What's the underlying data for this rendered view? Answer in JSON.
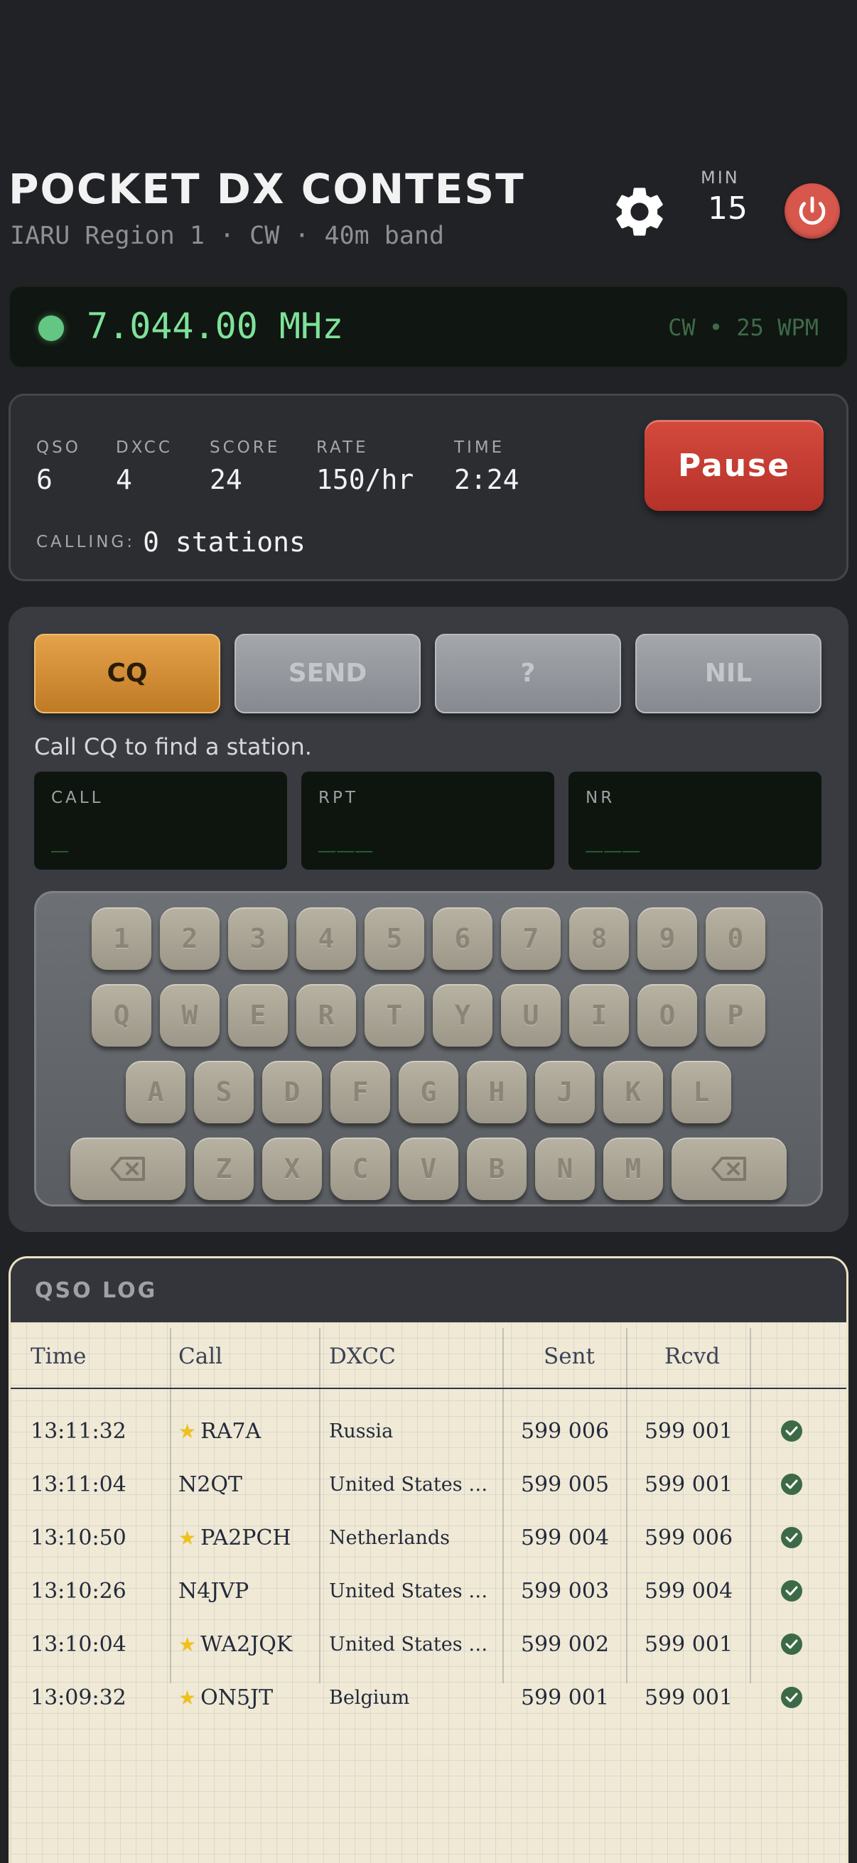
{
  "header": {
    "title": "POCKET DX CONTEST",
    "subtitle": "IARU Region 1 · CW · 40m band",
    "min_label": "MIN",
    "min_value": "15"
  },
  "radio": {
    "frequency": "7.044.00 MHz",
    "mode_info": "CW • 25 WPM",
    "status_color": "#63c783"
  },
  "stats": {
    "qso_label": "QSO",
    "qso_value": "6",
    "dxcc_label": "DXCC",
    "dxcc_value": "4",
    "score_label": "SCORE",
    "score_value": "24",
    "rate_label": "RATE",
    "rate_value": "150/hr",
    "time_label": "TIME",
    "time_value": "2:24",
    "calling_label": "CALLING:",
    "calling_value": "0 stations",
    "pause_label": "Pause"
  },
  "controls": {
    "buttons": [
      "CQ",
      "SEND",
      "?",
      "NIL"
    ],
    "active_button": "CQ",
    "prompt": "Call CQ to find a station.",
    "fields": [
      {
        "label": "CALL",
        "value": "_"
      },
      {
        "label": "RPT",
        "value": "___"
      },
      {
        "label": "NR",
        "value": "___"
      }
    ]
  },
  "keyboard": {
    "row1": [
      "1",
      "2",
      "3",
      "4",
      "5",
      "6",
      "7",
      "8",
      "9",
      "0"
    ],
    "row2": [
      "Q",
      "W",
      "E",
      "R",
      "T",
      "Y",
      "U",
      "I",
      "O",
      "P"
    ],
    "row3": [
      "A",
      "S",
      "D",
      "F",
      "G",
      "H",
      "J",
      "K",
      "L"
    ],
    "row4": [
      "Z",
      "X",
      "C",
      "V",
      "B",
      "N",
      "M"
    ],
    "backspace_icon": "backspace-icon"
  },
  "log": {
    "title": "QSO LOG",
    "columns": [
      "Time",
      "Call",
      "DXCC",
      "Sent",
      "Rcvd"
    ],
    "rows": [
      {
        "time": "13:11:32",
        "call": "RA7A",
        "starred": true,
        "dxcc": "Russia",
        "sent": "599 006",
        "rcvd": "599 001",
        "confirmed": true
      },
      {
        "time": "13:11:04",
        "call": "N2QT",
        "starred": false,
        "dxcc": "United States of America",
        "sent": "599 005",
        "rcvd": "599 001",
        "confirmed": true
      },
      {
        "time": "13:10:50",
        "call": "PA2PCH",
        "starred": true,
        "dxcc": "Netherlands",
        "sent": "599 004",
        "rcvd": "599 006",
        "confirmed": true
      },
      {
        "time": "13:10:26",
        "call": "N4JVP",
        "starred": false,
        "dxcc": "United States of America",
        "sent": "599 003",
        "rcvd": "599 004",
        "confirmed": true
      },
      {
        "time": "13:10:04",
        "call": "WA2JQK",
        "starred": true,
        "dxcc": "United States of America",
        "sent": "599 002",
        "rcvd": "599 001",
        "confirmed": true
      },
      {
        "time": "13:09:32",
        "call": "ON5JT",
        "starred": true,
        "dxcc": "Belgium",
        "sent": "599 001",
        "rcvd": "599 001",
        "confirmed": true
      }
    ],
    "star_color": "#f0c020",
    "check_color": "#3c6a47"
  }
}
